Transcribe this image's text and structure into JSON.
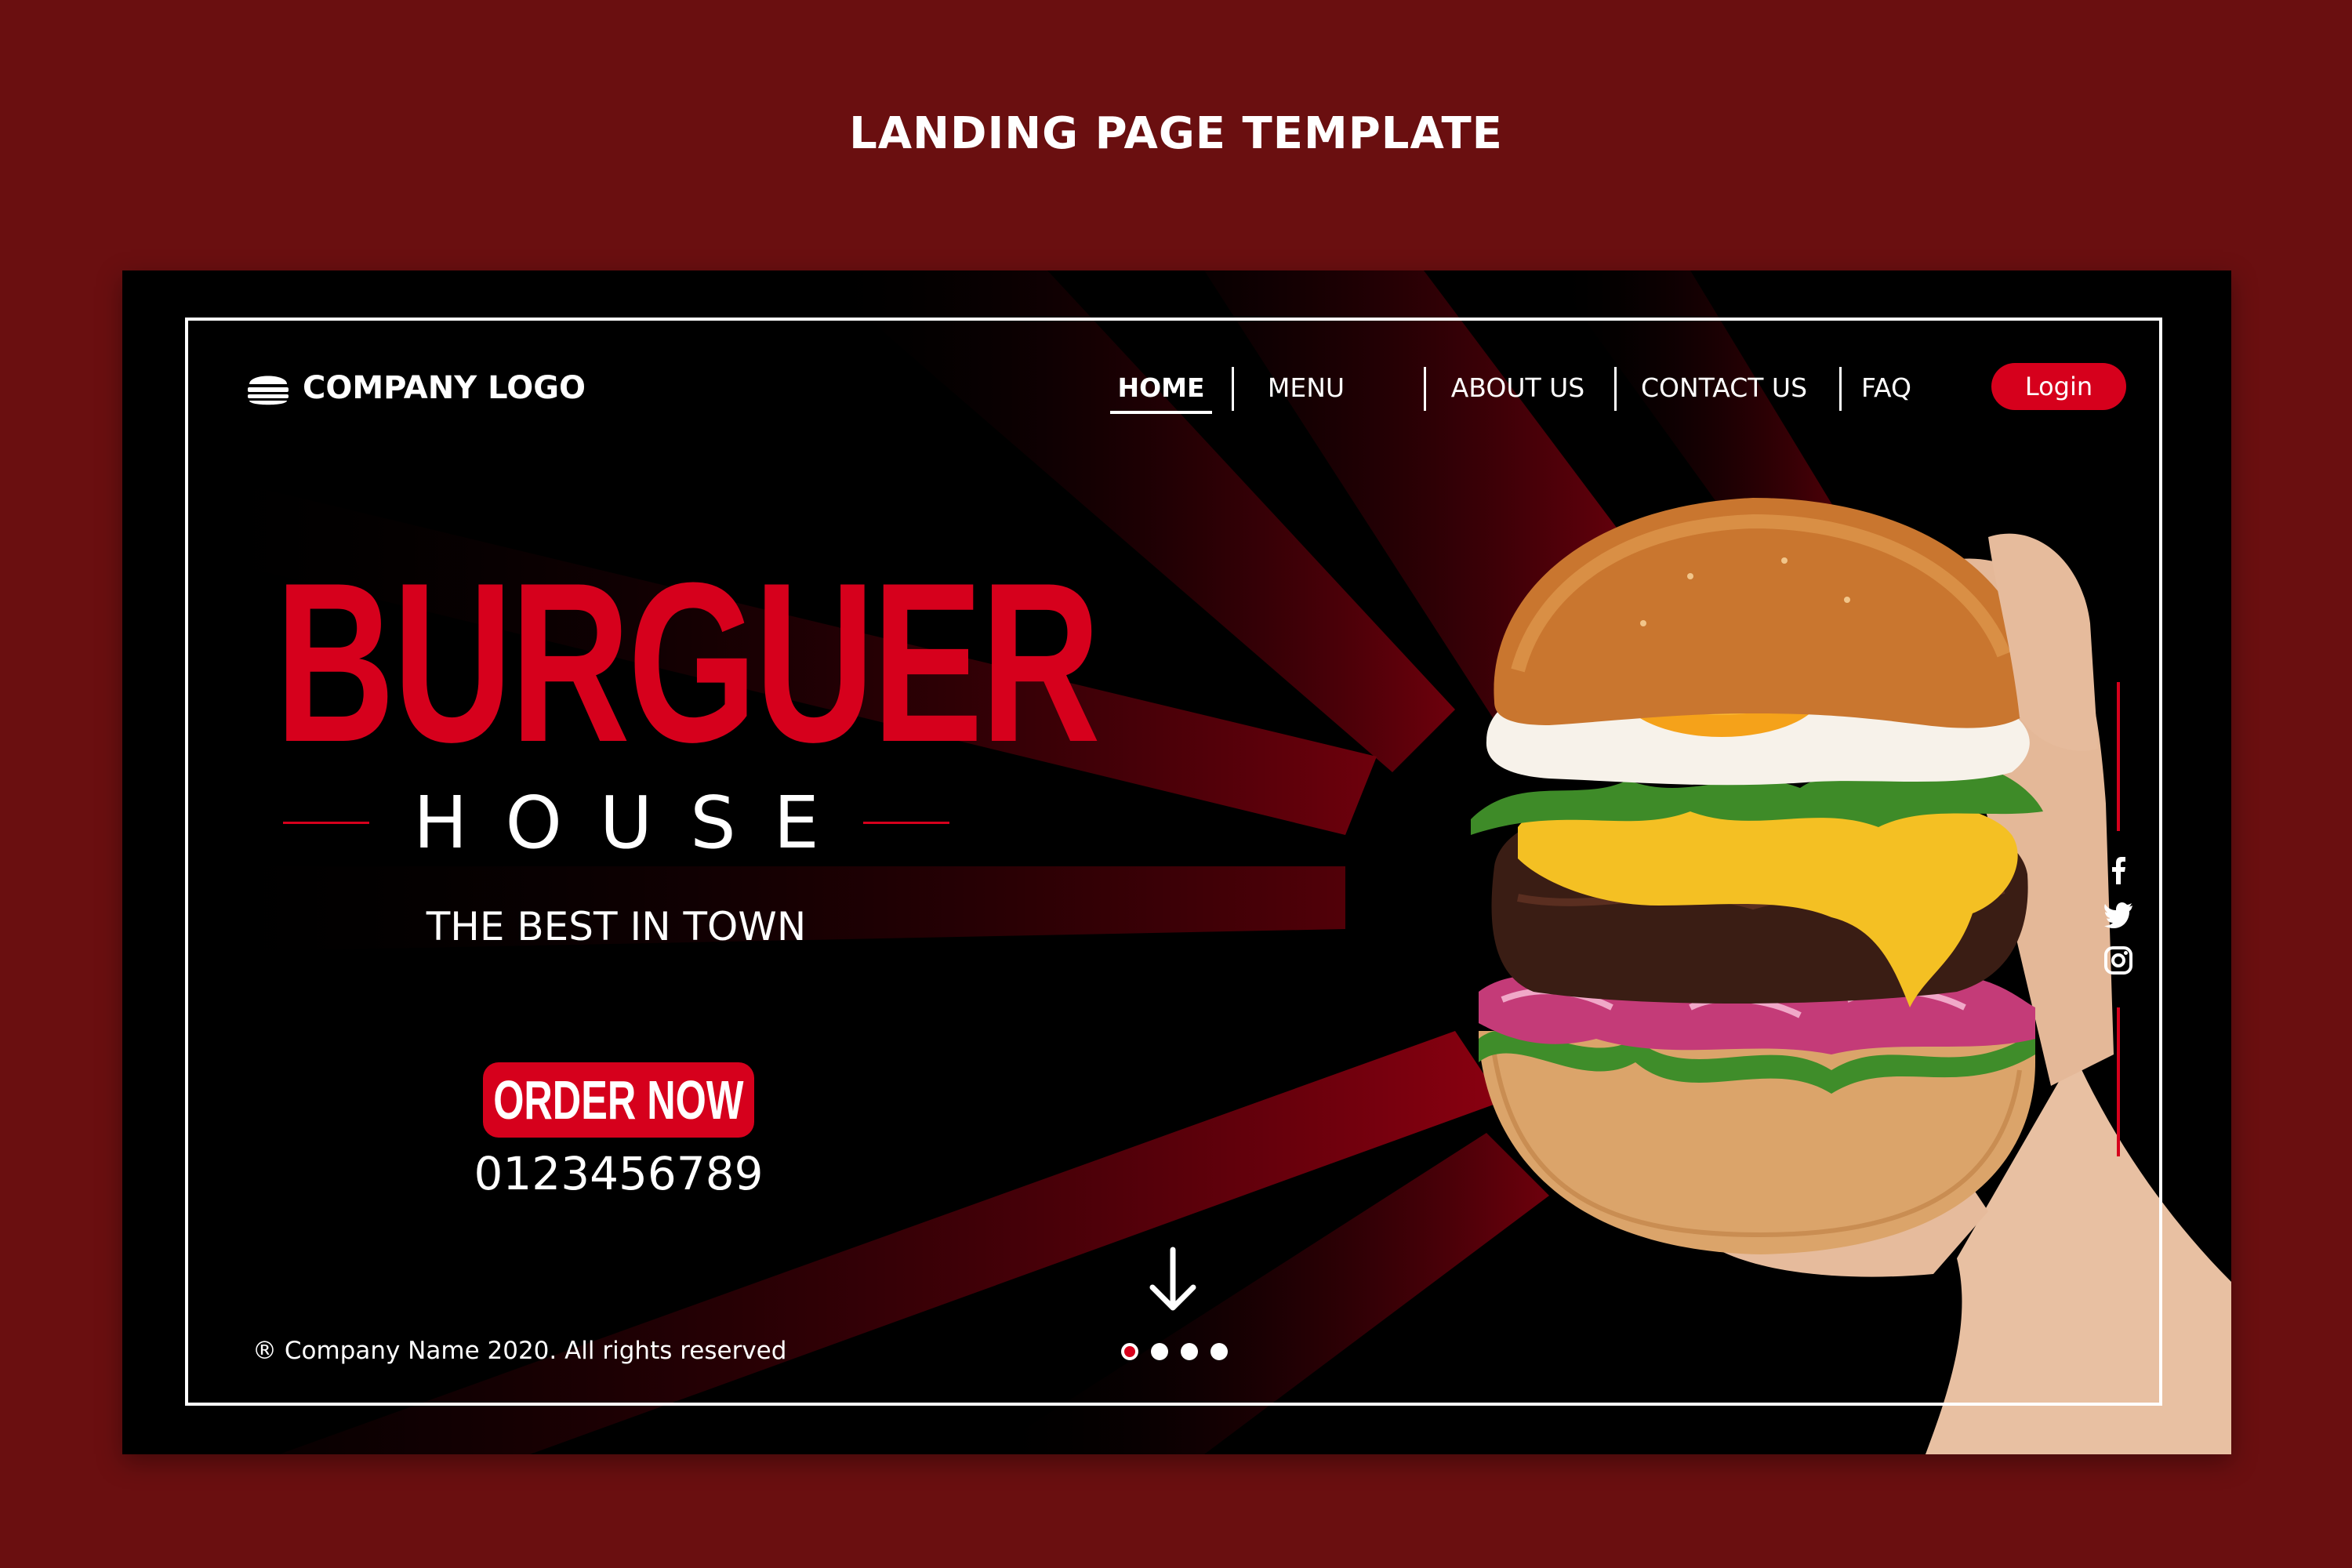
{
  "page_heading": "LANDING PAGE TEMPLATE",
  "header": {
    "logo_icon": "burger-icon",
    "logo_text": "COMPANY LOGO",
    "nav": [
      {
        "label": "HOME",
        "active": true
      },
      {
        "label": "MENU",
        "active": false
      },
      {
        "label": "ABOUT US",
        "active": false
      },
      {
        "label": "CONTACT US",
        "active": false
      },
      {
        "label": "FAQ",
        "active": false
      }
    ],
    "login_label": "Login"
  },
  "hero": {
    "title": "BURGUER",
    "subtitle": "HOUSE",
    "tagline": "THE BEST IN TOWN",
    "order_label": "ORDER NOW",
    "phone": "0123456789"
  },
  "footer": {
    "copyright": "® Company Name 2020. All rights reserved"
  },
  "pagination": {
    "total": 4,
    "active_index": 0
  },
  "social": [
    "facebook-icon",
    "twitter-icon",
    "instagram-icon"
  ],
  "colors": {
    "background": "#6a0f10",
    "canvas": "#000000",
    "accent": "#d6001c",
    "text": "#ffffff"
  }
}
